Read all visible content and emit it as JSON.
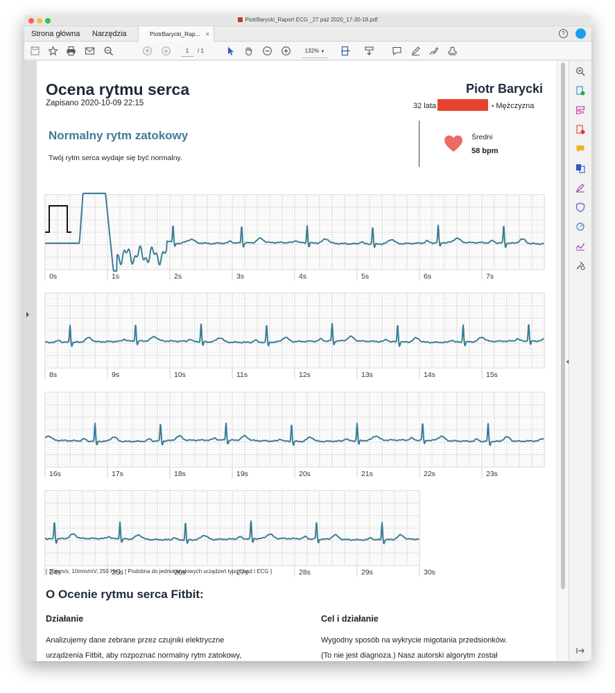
{
  "window": {
    "title": "PiotrBarycki_Raport ECG _27 paź 2020_17-30-18.pdf",
    "colors": {
      "close": "#fd5f57",
      "minimize": "#febc2e",
      "maximize": "#28c840"
    }
  },
  "tabs": {
    "home": "Strona główna",
    "tools": "Narzędzia",
    "document": "PiotrBarycki_Rap...",
    "close_symbol": "×",
    "help_symbol": "?"
  },
  "toolbar": {
    "page_current": "1",
    "page_total": "/ 1",
    "zoom": "132%",
    "icons": [
      "save-icon",
      "bookmark-star-icon",
      "print-icon",
      "email-icon",
      "search-icon",
      "prev-page-icon",
      "next-page-icon",
      "select-cursor-icon",
      "hand-icon",
      "zoom-out-icon",
      "zoom-in-icon",
      "fit-page-icon",
      "scroll-mode-icon",
      "comment-icon",
      "highlight-pen-icon",
      "draw-icon",
      "stamp-icon"
    ]
  },
  "right_panel_icons": [
    "zoom-icon",
    "export-pdf-icon",
    "organize-pages-icon",
    "edit-pdf-icon",
    "comment-icon",
    "combine-files-icon",
    "fill-sign-icon",
    "protect-icon",
    "optimize-icon",
    "sign-icon",
    "more-tools-icon",
    "collapse-panel-icon"
  ],
  "report": {
    "title": "Ocena rytmu serca",
    "saved": "Zapisano 2020-10-09 22:15",
    "patient_name": "Piotr Barycki",
    "age": "32 lata",
    "separator": "•",
    "sex": "Mężczyzna",
    "result_title": "Normalny rytm zatokowy",
    "result_desc": "Twój rytm serca wydaje się być normalny.",
    "avg_label": "Średni",
    "avg_bpm": "58 bpm",
    "colors": {
      "trace": "#3a7d97",
      "heading": "#3d7d97",
      "heart": "#ef6a66",
      "redaction": "#e8432e"
    }
  },
  "ecg": {
    "strips": [
      {
        "ticks": [
          "0s",
          "1s",
          "2s",
          "3s",
          "4s",
          "5s",
          "6s",
          "7s"
        ]
      },
      {
        "ticks": [
          "8s",
          "9s",
          "10s",
          "11s",
          "12s",
          "13s",
          "14s",
          "15s"
        ]
      },
      {
        "ticks": [
          "16s",
          "17s",
          "18s",
          "19s",
          "20s",
          "21s",
          "22s",
          "23s"
        ]
      },
      {
        "ticks": [
          "24s",
          "25s",
          "26s",
          "27s",
          "28s",
          "29s",
          "30s"
        ]
      }
    ],
    "beat_times_s": [
      2.05,
      3.15,
      4.2,
      5.25,
      6.3,
      7.35,
      8.4,
      9.45,
      10.5,
      11.55,
      12.6,
      13.65,
      14.7,
      15.75,
      16.8,
      17.85,
      18.9,
      19.95,
      21.0,
      22.05,
      23.1,
      24.15,
      25.2,
      26.25,
      27.3,
      28.35,
      29.4
    ]
  },
  "footnote": "[ 25mm/s, 10mm/mV, 250 Hz ] : [ Podobna do jednokanałowych urządzeń typu Lead I ECG ]",
  "about": {
    "title": "O Ocenie rytmu serca Fitbit:",
    "left_heading": "Działanie",
    "left_lines": [
      "Analizujemy dane zebrane przez czujniki elektryczne",
      "urządzenia Fitbit, aby rozpoznać normalny rytm zatokowy,"
    ],
    "right_heading": "Cel i działanie",
    "right_lines": [
      "Wygodny sposób na wykrycie migotania przedsionków.",
      "(To nie jest diagnoza.) Nasz autorski algorytm został"
    ]
  }
}
